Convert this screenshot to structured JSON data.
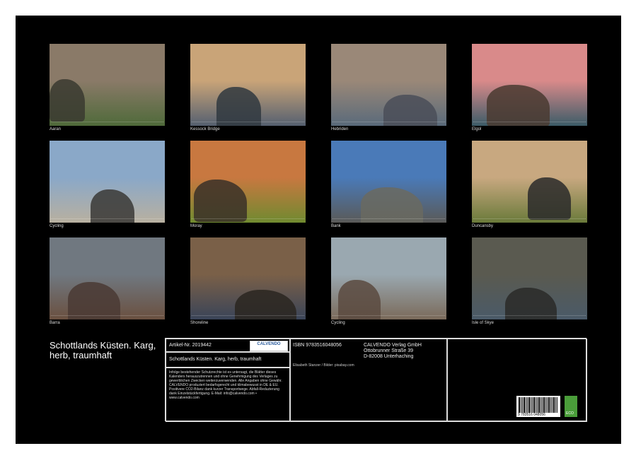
{
  "calendar": {
    "title": "Schottlands Küsten. Karg, herb, traumhaft",
    "months": [
      {
        "caption": "Aaran"
      },
      {
        "caption": "Kessock Bridge"
      },
      {
        "caption": "Hebriden"
      },
      {
        "caption": "Elgol"
      },
      {
        "caption": "Cycling"
      },
      {
        "caption": "Moray"
      },
      {
        "caption": "Bank"
      },
      {
        "caption": "Duncansby"
      },
      {
        "caption": "Barra"
      },
      {
        "caption": "Shoreline"
      },
      {
        "caption": "Cycling"
      },
      {
        "caption": "Isle of Skye"
      }
    ]
  },
  "info": {
    "article": "Artikel-Nr. 2019442",
    "logo": "CALVENDO",
    "subtitle": "Schottlands Küsten. Karg, herb, traumhaft",
    "legal": "Infolge bestehender Schutzrechte ist es untersagt, die Blätter dieses Kalenders herauszutrennen und ohne Genehmigung des Verlages zu gewerblichen Zwecken weiterzuverwenden. Alle Angaben ohne Gewähr. CALVENDO produziert bedarfsgerecht und klimabewusst in DE & EU. Positivere CO2-Bilanz dank kurzer Transportwege. Abfall-Reduzierung dank Einzelstückfertigung. E-Mail: info@calvendo.com • www.calvendo.com",
    "isbn": "ISBN 9783516048056",
    "publisher_line1": "CALVENDO Verlag GmbH",
    "publisher_line2": "Ottobrunner Straße 39",
    "publisher_line3": "D-82008 Unterhaching",
    "credits": "Elisabeth Stanzer / Bilder: pixabay.com",
    "barcode_number": "9 783516 048056",
    "eco_label": "ECO"
  },
  "thumb_colors": [
    {
      "sky": "#8a7a68",
      "land": "#4f6a3a",
      "rock": "#3a3a30"
    },
    {
      "sky": "#c9a478",
      "land": "#556070",
      "rock": "#303840"
    },
    {
      "sky": "#9a8878",
      "land": "#5a6a7a",
      "rock": "#4a4e58"
    },
    {
      "sky": "#d98a8a",
      "land": "#3c5c68",
      "rock": "#4a3a30"
    },
    {
      "sky": "#8aa8c8",
      "land": "#b8b0a0",
      "rock": "#3a3836"
    },
    {
      "sky": "#c87840",
      "land": "#708a30",
      "rock": "#3a3028"
    },
    {
      "sky": "#4a7ab8",
      "land": "#5a5a58",
      "rock": "#6a6a60"
    },
    {
      "sky": "#c8a880",
      "land": "#6a7a3a",
      "rock": "#2a2a2a"
    },
    {
      "sky": "#707880",
      "land": "#6a5040",
      "rock": "#4a3a34"
    },
    {
      "sky": "#7a6048",
      "land": "#3a4458",
      "rock": "#2a2620"
    },
    {
      "sky": "#9aa8b0",
      "land": "#7a6a5a",
      "rock": "#5a4a40"
    },
    {
      "sky": "#5a5a50",
      "land": "#4a5a68",
      "rock": "#2a2a28"
    }
  ]
}
